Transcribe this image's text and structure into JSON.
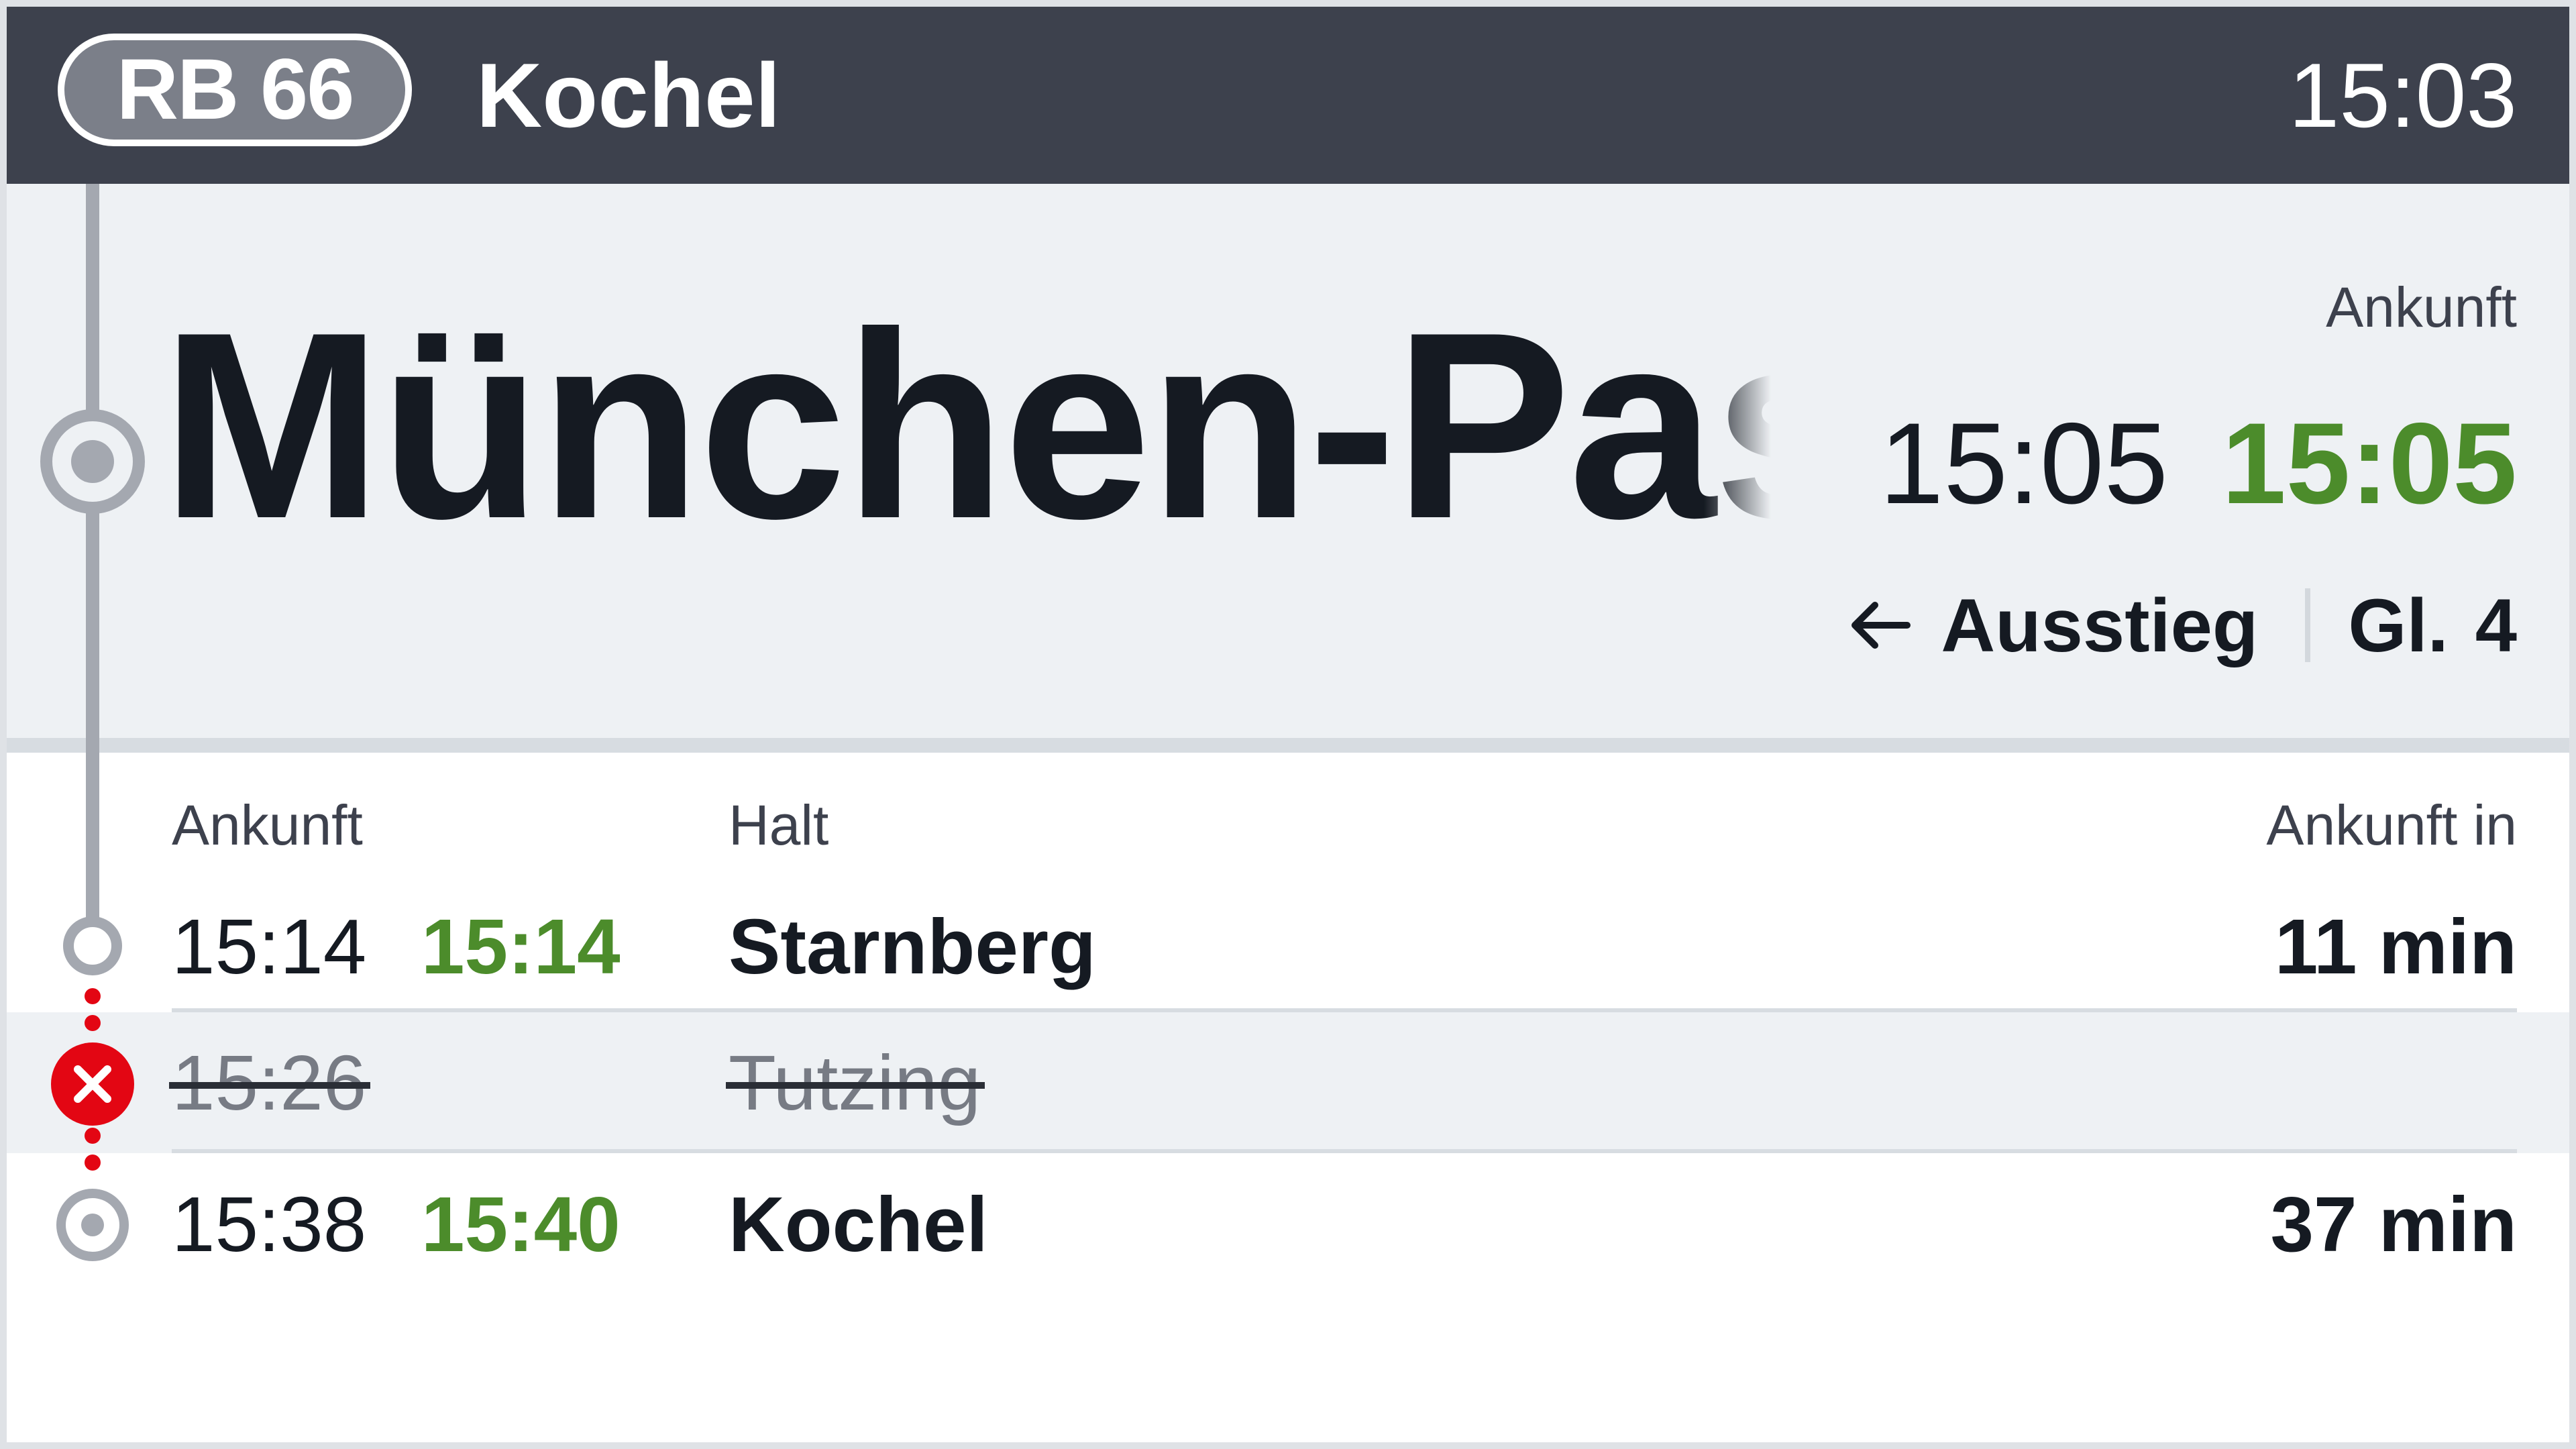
{
  "header": {
    "line_badge": "RB 66",
    "destination": "Kochel",
    "clock": "15:03"
  },
  "current_stop": {
    "name": "München-Pasing",
    "arrival_label": "Ankunft",
    "planned_time": "15:05",
    "actual_time": "15:05",
    "exit_side_icon": "arrow-left-icon",
    "exit_label": "Ausstieg",
    "platform_label": "Gl.",
    "platform_number": "4"
  },
  "columns": {
    "arrival": "Ankunft",
    "stop": "Halt",
    "arrival_in": "Ankunft in"
  },
  "stops": [
    {
      "planned": "15:14",
      "actual": "15:14",
      "name": "Starnberg",
      "eta": "11 min",
      "cancelled": false
    },
    {
      "planned": "15:26",
      "actual": "",
      "name": "Tutzing",
      "eta": "",
      "cancelled": true
    },
    {
      "planned": "15:38",
      "actual": "15:40",
      "name": "Kochel",
      "eta": "37 min",
      "cancelled": false,
      "terminus": true
    }
  ],
  "colors": {
    "header_bg": "#3d414d",
    "on_time_green": "#4c8c2b",
    "cancelled_red": "#e30613",
    "panel_bg": "#eef1f4"
  }
}
